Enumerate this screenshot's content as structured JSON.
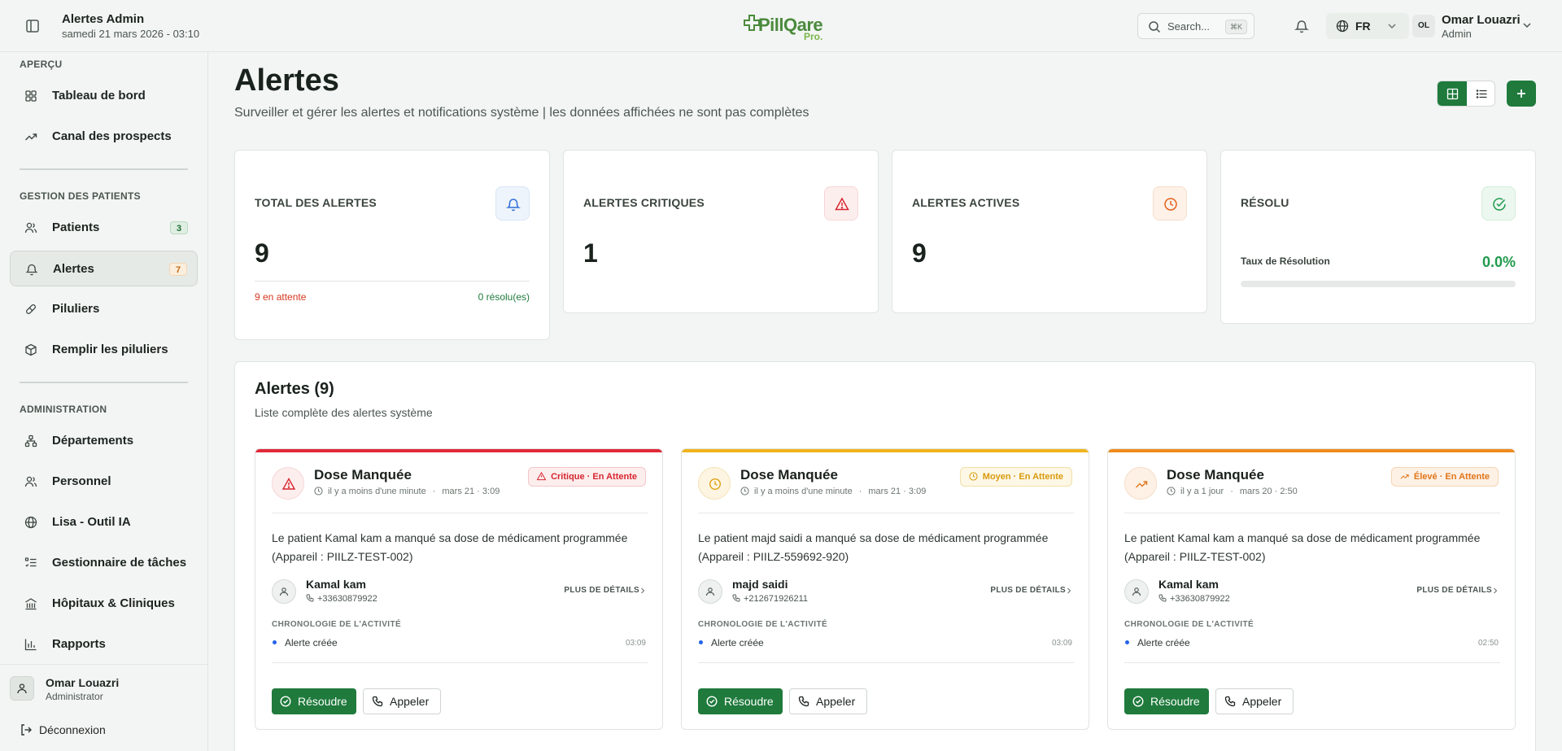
{
  "header": {
    "app_title": "Alertes Admin",
    "datetime": "samedi 21 mars 2026 - 03:10",
    "logo_text": "PillQare",
    "logo_suffix": "Pro.",
    "search_placeholder": "Search...",
    "search_shortcut": "⌘K",
    "language": "FR",
    "user": {
      "initials": "OL",
      "name": "Omar Louazri",
      "role": "Admin"
    }
  },
  "sidebar": {
    "sections": [
      {
        "label": "APERÇU",
        "items": [
          {
            "label": "Tableau de bord",
            "icon": "dashboard-icon"
          },
          {
            "label": "Canal des prospects",
            "icon": "trending-up-icon"
          }
        ]
      },
      {
        "label": "GESTION DES PATIENTS",
        "items": [
          {
            "label": "Patients",
            "icon": "users-icon",
            "badge": "3"
          },
          {
            "label": "Alertes",
            "icon": "bell-icon",
            "badge": "7",
            "active": true
          },
          {
            "label": "Piluliers",
            "icon": "pill-icon"
          },
          {
            "label": "Remplir les piluliers",
            "icon": "package-icon"
          }
        ]
      },
      {
        "label": "ADMINISTRATION",
        "items": [
          {
            "label": "Départements",
            "icon": "network-icon"
          },
          {
            "label": "Personnel",
            "icon": "users-icon"
          },
          {
            "label": "Lisa - Outil IA",
            "icon": "globe-icon"
          },
          {
            "label": "Gestionnaire de tâches",
            "icon": "task-list-icon"
          },
          {
            "label": "Hôpitaux & Cliniques",
            "icon": "building-icon"
          },
          {
            "label": "Rapports",
            "icon": "bar-chart-icon"
          }
        ]
      }
    ],
    "user": {
      "name": "Omar Louazri",
      "role": "Administrator"
    },
    "logout_label": "Déconnexion"
  },
  "page": {
    "title": "Alertes",
    "subtitle": "Surveiller et gérer les alertes et notifications système | les données affichées ne sont pas complètes"
  },
  "stats": {
    "total": {
      "label": "TOTAL DES ALERTES",
      "value": "9",
      "pending": "9 en attente",
      "resolved": "0 résolu(es)"
    },
    "critical": {
      "label": "ALERTES CRITIQUES",
      "value": "1"
    },
    "active": {
      "label": "ALERTES ACTIVES",
      "value": "9"
    },
    "resolved": {
      "label": "RÉSOLU",
      "rate_label": "Taux de Résolution",
      "rate_value": "0.0%",
      "rate_fraction": 0.0
    }
  },
  "list": {
    "title": "Alertes (9)",
    "subtitle": "Liste complète des alertes système",
    "more_label": "PLUS DE DÉTAILS",
    "timeline_label": "CHRONOLOGIE DE L'ACTIVITÉ",
    "resolve_label": "Résoudre",
    "call_label": "Appeler",
    "alerts": [
      {
        "title": "Dose Manquée",
        "ago": "il y a moins d'une minute",
        "date": "mars 21 · 3:09",
        "severity": "Critique",
        "status": "En Attente",
        "severity_color": "#e0293a",
        "description": "Le patient Kamal kam a manqué sa dose de médicament programmée (Appareil : PIILZ-TEST-002)",
        "patient": "Kamal kam",
        "phone": "+33630879922",
        "event": "Alerte créée",
        "event_time": "03:09"
      },
      {
        "title": "Dose Manquée",
        "ago": "il y a moins d'une minute",
        "date": "mars 21 · 3:09",
        "severity": "Moyen",
        "status": "En Attente",
        "severity_color": "#f0b41c",
        "description": "Le patient majd saidi a manqué sa dose de médicament programmée (Appareil : PIILZ-559692-920)",
        "patient": "majd saidi",
        "phone": "+212671926211",
        "event": "Alerte créée",
        "event_time": "03:09"
      },
      {
        "title": "Dose Manquée",
        "ago": "il y a 1 jour",
        "date": "mars 20 · 2:50",
        "severity": "Élevé",
        "status": "En Attente",
        "severity_color": "#f08a1c",
        "description": "Le patient Kamal kam a manqué sa dose de médicament programmée (Appareil : PIILZ-TEST-002)",
        "patient": "Kamal kam",
        "phone": "+33630879922",
        "event": "Alerte créée",
        "event_time": "02:50"
      }
    ]
  }
}
